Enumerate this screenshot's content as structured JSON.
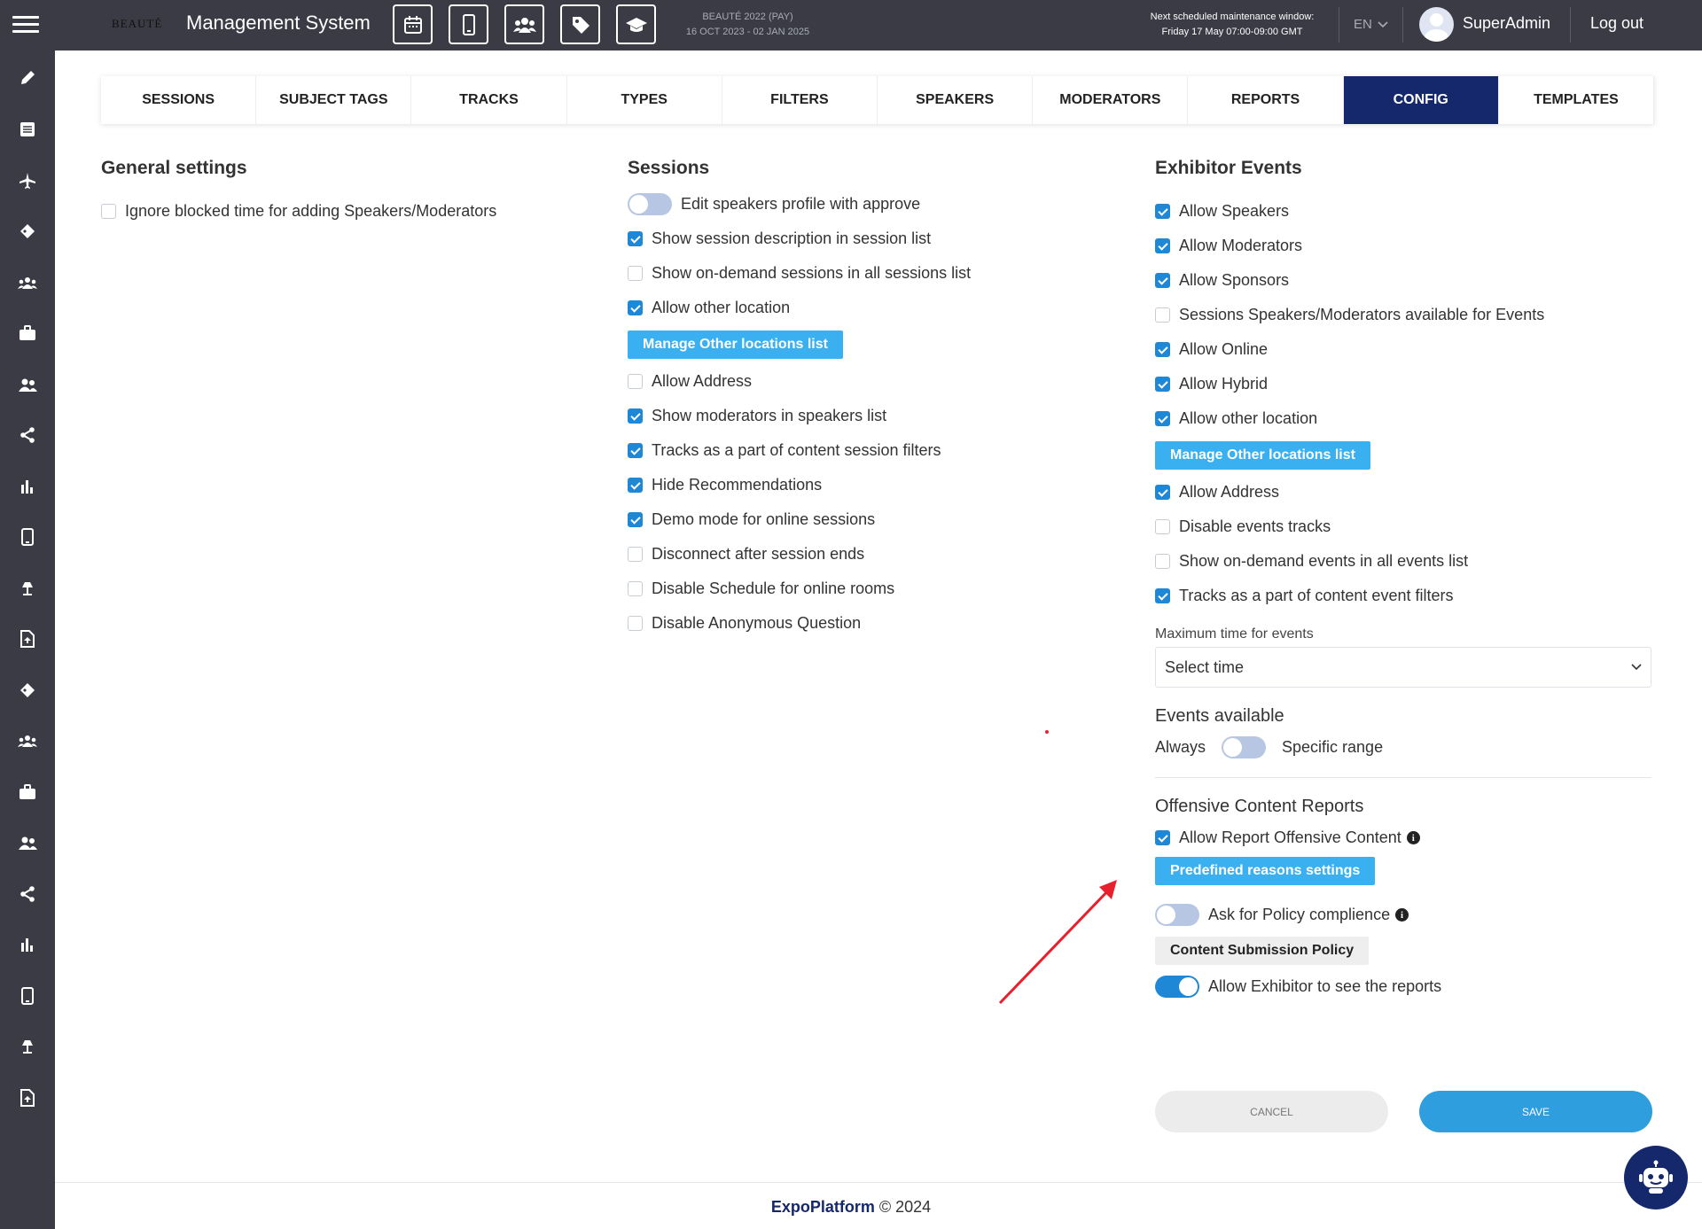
{
  "header": {
    "logo_text": "BEAUTÉ",
    "app_title": "Management System",
    "event_name": "BEAUTÉ 2022 (PAY)",
    "event_dates": "16 OCT 2023 - 02 JAN 2025",
    "maintenance_label": "Next scheduled maintenance window:",
    "maintenance_time": "Friday 17 May 07:00-09:00 GMT",
    "language": "EN",
    "username": "SuperAdmin",
    "logout": "Log out"
  },
  "tabs": [
    "SESSIONS",
    "SUBJECT TAGS",
    "TRACKS",
    "TYPES",
    "FILTERS",
    "SPEAKERS",
    "MODERATORS",
    "REPORTS",
    "CONFIG",
    "TEMPLATES"
  ],
  "active_tab": "CONFIG",
  "general": {
    "title": "General settings",
    "items": [
      {
        "label": "Ignore blocked time for adding Speakers/Moderators",
        "checked": false
      }
    ]
  },
  "sessions": {
    "title": "Sessions",
    "toggle_label": "Edit speakers profile with approve",
    "toggle_on": false,
    "items_a": [
      {
        "label": "Show session description in session list",
        "checked": true
      },
      {
        "label": "Show on-demand sessions in all sessions list",
        "checked": false
      },
      {
        "label": "Allow other location",
        "checked": true
      }
    ],
    "manage_button": "Manage Other locations list",
    "items_b": [
      {
        "label": "Allow Address",
        "checked": false
      },
      {
        "label": "Show moderators in speakers list",
        "checked": true
      },
      {
        "label": "Tracks as a part of content session filters",
        "checked": true
      },
      {
        "label": "Hide Recommendations",
        "checked": true
      },
      {
        "label": "Demo mode for online sessions",
        "checked": true
      },
      {
        "label": "Disconnect after session ends",
        "checked": false
      },
      {
        "label": "Disable Schedule for online rooms",
        "checked": false
      },
      {
        "label": "Disable Anonymous Question",
        "checked": false
      }
    ]
  },
  "exhibitor": {
    "title": "Exhibitor Events",
    "items_a": [
      {
        "label": "Allow Speakers",
        "checked": true
      },
      {
        "label": "Allow Moderators",
        "checked": true
      },
      {
        "label": "Allow Sponsors",
        "checked": true
      },
      {
        "label": "Sessions Speakers/Moderators available for Events",
        "checked": false
      },
      {
        "label": "Allow Online",
        "checked": true
      },
      {
        "label": "Allow Hybrid",
        "checked": true
      },
      {
        "label": "Allow other location",
        "checked": true
      }
    ],
    "manage_button": "Manage Other locations list",
    "items_b": [
      {
        "label": "Allow Address",
        "checked": true
      },
      {
        "label": "Disable events tracks",
        "checked": false
      },
      {
        "label": "Show on-demand events in all events list",
        "checked": false
      },
      {
        "label": "Tracks as a part of content event filters",
        "checked": true
      }
    ],
    "max_time_label": "Maximum time for events",
    "max_time_value": "Select time",
    "events_available_title": "Events available",
    "always_label": "Always",
    "specific_label": "Specific range",
    "events_range_on": false
  },
  "offensive": {
    "title": "Offensive Content Reports",
    "allow_report_label": "Allow Report Offensive Content",
    "allow_report_checked": true,
    "reasons_button": "Predefined reasons settings",
    "policy_label": "Ask for Policy complience",
    "policy_on": false,
    "policy_button": "Content Submission Policy",
    "exhibitor_see_label": "Allow Exhibitor to see the reports",
    "exhibitor_see_on": true
  },
  "actions": {
    "cancel": "CANCEL",
    "save": "SAVE"
  },
  "footer": {
    "brand": "ExpoPlatform",
    "copyright": "© 2024"
  },
  "colors": {
    "accent": "#1e88d6",
    "button": "#3bb0f0",
    "navy": "#15286c",
    "annotation": "#e8202e"
  },
  "sidebar_icons": [
    "pencil-icon",
    "list-icon",
    "plane-icon",
    "tag-icon",
    "group-icon",
    "briefcase-icon",
    "users-icon",
    "share-icon",
    "bar-chart-icon",
    "mobile-icon",
    "lamp-icon",
    "file-upload-icon",
    "tag-icon",
    "group-icon",
    "briefcase-icon",
    "users-icon",
    "share-icon",
    "bar-chart-icon",
    "mobile-icon",
    "lamp-icon",
    "file-upload-icon"
  ]
}
